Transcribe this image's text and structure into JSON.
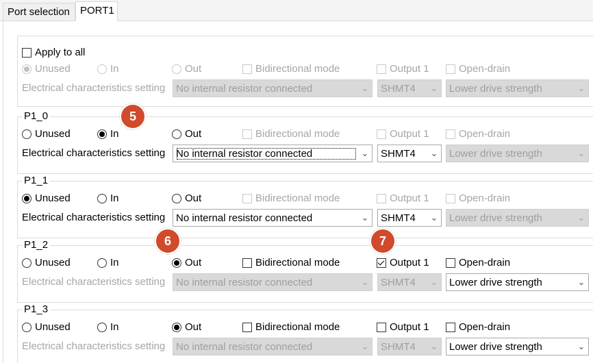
{
  "tabs": [
    {
      "label": "Port selection",
      "active": false
    },
    {
      "label": "PORT1",
      "active": true
    }
  ],
  "labels": {
    "unused": "Unused",
    "in": "In",
    "out": "Out",
    "bidirectional": "Bidirectional mode",
    "output1": "Output 1",
    "open_drain": "Open-drain",
    "elec": "Electrical characteristics setting"
  },
  "all": {
    "apply_label": "Apply to all",
    "apply_checked": false,
    "direction": "Unused",
    "resistor": "No internal resistor connected",
    "shmt": "SHMT4",
    "drive": "Lower drive strength"
  },
  "ports": [
    {
      "title": "P1_0",
      "direction": "In",
      "bidirectional": false,
      "output1": false,
      "open_drain": false,
      "resistor": "No internal resistor connected",
      "shmt": "SHMT4",
      "drive": "Lower drive strength"
    },
    {
      "title": "P1_1",
      "direction": "Unused",
      "bidirectional": false,
      "output1": false,
      "open_drain": false,
      "resistor": "No internal resistor connected",
      "shmt": "SHMT4",
      "drive": "Lower drive strength"
    },
    {
      "title": "P1_2",
      "direction": "Out",
      "bidirectional": false,
      "output1": true,
      "open_drain": false,
      "resistor": "No internal resistor connected",
      "shmt": "SHMT4",
      "drive": "Lower drive strength"
    },
    {
      "title": "P1_3",
      "direction": "Out",
      "bidirectional": false,
      "output1": false,
      "open_drain": false,
      "resistor": "No internal resistor connected",
      "shmt": "SHMT4",
      "drive": "Lower drive strength"
    }
  ],
  "badges": [
    "5",
    "6",
    "7"
  ],
  "colors": {
    "badge": "#d04b2b",
    "disabled_text": "#a6a6a6",
    "disabled_field": "#d9d9d9"
  }
}
